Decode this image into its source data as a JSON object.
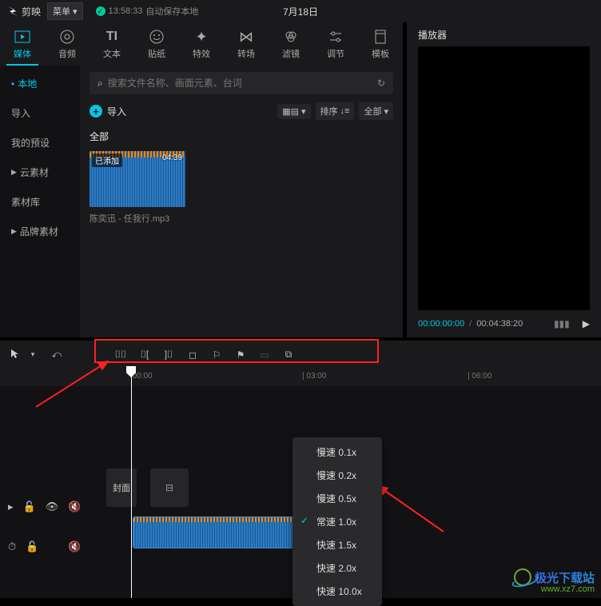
{
  "app_name": "剪映",
  "menu_label": "菜单",
  "save_time": "13:58:33",
  "save_text": "自动保存本地",
  "filename": "7月18日",
  "top_tabs": [
    {
      "label": "媒体"
    },
    {
      "label": "音频"
    },
    {
      "label": "文本"
    },
    {
      "label": "贴纸"
    },
    {
      "label": "特效"
    },
    {
      "label": "转场"
    },
    {
      "label": "滤镜"
    },
    {
      "label": "调节"
    },
    {
      "label": "模板"
    }
  ],
  "side_nav": [
    {
      "label": "本地"
    },
    {
      "label": "导入"
    },
    {
      "label": "我的预设"
    },
    {
      "label": "云素材"
    },
    {
      "label": "素材库"
    },
    {
      "label": "品牌素材"
    }
  ],
  "search_placeholder": "搜索文件名称、画面元素、台词",
  "import_label": "导入",
  "sort_label": "排序",
  "filter_label": "全部",
  "category_all": "全部",
  "media": {
    "badge": "已添加",
    "duration": "04:39",
    "name": "陈奕迅 - 任我行.mp3"
  },
  "player": {
    "title": "播放器",
    "current": "00:00:00:00",
    "total": "00:04:38:20"
  },
  "ruler": {
    "t0": "|00:00",
    "t1": "| 03:00",
    "t2": "| 06:00"
  },
  "cover_label": "封面",
  "audio_speed": "1.00x",
  "speed_menu": [
    "慢速 0.1x",
    "慢速 0.2x",
    "慢速 0.5x",
    "常速 1.0x",
    "快速 1.5x",
    "快速 2.0x",
    "快速 10.0x"
  ],
  "watermark": {
    "text": "极光下载站",
    "url": "www.xz7.com"
  }
}
